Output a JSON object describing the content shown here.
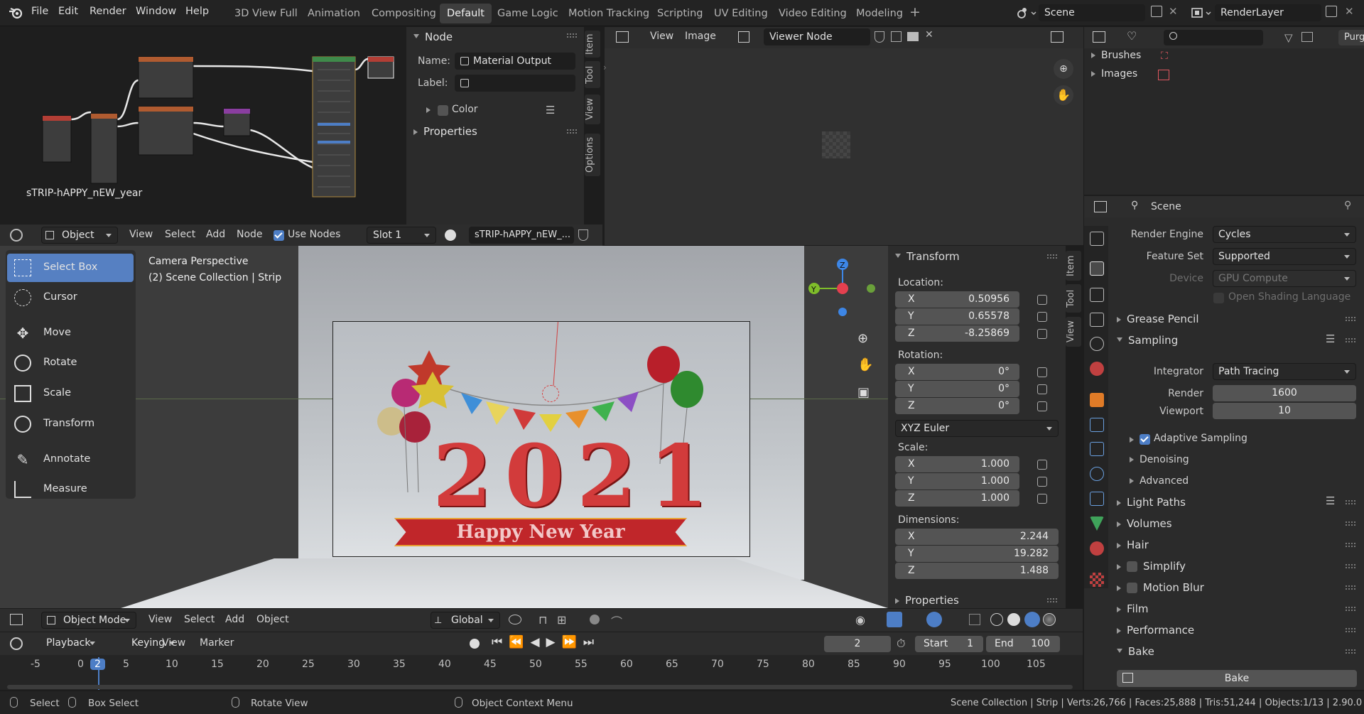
{
  "topbar": {
    "menus": [
      "File",
      "Edit",
      "Render",
      "Window",
      "Help"
    ],
    "workspaces": [
      "3D View Full",
      "Animation",
      "Compositing",
      "Default",
      "Game Logic",
      "Motion Tracking",
      "Scripting",
      "UV Editing",
      "Video Editing",
      "Modeling"
    ],
    "active_workspace": "Default",
    "scene": "Scene",
    "view_layer": "RenderLayer"
  },
  "node_editor": {
    "tree_label": "sTRIP-hAPPY_nEW_year",
    "header": {
      "mode": "Object",
      "menus": [
        "View",
        "Select",
        "Add",
        "Node"
      ],
      "use_nodes": "Use Nodes",
      "slot": "Slot 1",
      "material": "sTRIP-hAPPY_nEW_..."
    },
    "sidebar": {
      "title": "Node",
      "name_label": "Name:",
      "name_value": "Material Output",
      "label_label": "Label:",
      "label_value": "",
      "color": "Color",
      "properties": "Properties"
    },
    "tabs": [
      "Item",
      "Tool",
      "View",
      "Options"
    ]
  },
  "image_editor": {
    "menus": [
      "View",
      "Image"
    ],
    "node": "Viewer Node"
  },
  "outliner": {
    "items": [
      "Brushes",
      "Images"
    ],
    "pin": "Purg"
  },
  "viewport": {
    "overlay_title": "Camera Perspective",
    "overlay_sub": "(2) Scene Collection | Strip",
    "tools": [
      "Select Box",
      "Cursor",
      "Move",
      "Rotate",
      "Scale",
      "Transform",
      "Annotate",
      "Measure"
    ],
    "header": {
      "mode": "Object Mode",
      "menus": [
        "View",
        "Select",
        "Add",
        "Object"
      ],
      "orientation": "Global"
    },
    "render_text": {
      "year": "2021",
      "banner": "Happy New Year"
    },
    "tabs": [
      "Item",
      "Tool",
      "View"
    ]
  },
  "transform": {
    "title": "Transform",
    "location_label": "Location:",
    "location": {
      "X": "0.50956",
      "Y": "0.65578",
      "Z": "-8.25869"
    },
    "rotation_label": "Rotation:",
    "rotation": {
      "X": "0°",
      "Y": "0°",
      "Z": "0°"
    },
    "rotation_mode": "XYZ Euler",
    "scale_label": "Scale:",
    "scale": {
      "X": "1.000",
      "Y": "1.000",
      "Z": "1.000"
    },
    "dimensions_label": "Dimensions:",
    "dimensions": {
      "X": "2.244",
      "Y": "19.282",
      "Z": "1.488"
    },
    "properties": "Properties"
  },
  "properties": {
    "context": "Scene",
    "render_engine_label": "Render Engine",
    "render_engine": "Cycles",
    "feature_set_label": "Feature Set",
    "feature_set": "Supported",
    "device_label": "Device",
    "device": "GPU Compute",
    "osl": "Open Shading Language",
    "sections": [
      "Grease Pencil",
      "Sampling",
      "Light Paths",
      "Volumes",
      "Hair",
      "Simplify",
      "Motion Blur",
      "Film",
      "Performance",
      "Bake"
    ],
    "integrator_label": "Integrator",
    "integrator": "Path Tracing",
    "render_label": "Render",
    "render_samples": "1600",
    "viewport_label": "Viewport",
    "viewport_samples": "10",
    "sub": [
      "Adaptive Sampling",
      "Denoising",
      "Advanced"
    ],
    "bake_button": "Bake"
  },
  "timeline": {
    "menus": [
      "Playback",
      "Keying",
      "View",
      "Marker"
    ],
    "current_frame": "2",
    "start_label": "Start",
    "start": "1",
    "end_label": "End",
    "end": "100",
    "ticks": [
      "-5",
      "0",
      "2",
      "5",
      "10",
      "15",
      "20",
      "25",
      "30",
      "35",
      "40",
      "45",
      "50",
      "55",
      "60",
      "65",
      "70",
      "75",
      "80",
      "85",
      "90",
      "95",
      "100",
      "105"
    ]
  },
  "status": {
    "select": "Select",
    "box_select": "Box Select",
    "rotate": "Rotate View",
    "context": "Object Context Menu",
    "stats": "Scene Collection | Strip | Verts:26,766 | Faces:25,888 | Tris:51,244 | Objects:1/13 | 2.90.0"
  },
  "colors": {
    "accent": "#5680c2",
    "x_axis": "#e4404f",
    "y_axis": "#7fbd2a",
    "z_axis": "#3d86e6",
    "banner": "#c0262a"
  }
}
